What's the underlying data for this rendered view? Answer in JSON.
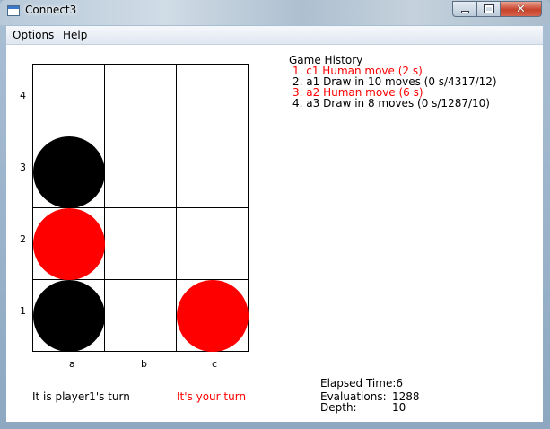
{
  "window": {
    "title": "Connect3",
    "colors": {
      "red": "#ff0000",
      "black": "#000000"
    }
  },
  "menu": {
    "items": [
      "Options",
      "Help"
    ]
  },
  "board": {
    "rows": [
      "4",
      "3",
      "2",
      "1"
    ],
    "columns": [
      "a",
      "b",
      "c"
    ],
    "discs": [
      {
        "col": "a",
        "row": "3",
        "color": "black"
      },
      {
        "col": "a",
        "row": "2",
        "color": "red"
      },
      {
        "col": "a",
        "row": "1",
        "color": "black"
      },
      {
        "col": "c",
        "row": "1",
        "color": "red"
      }
    ]
  },
  "history": {
    "title": "Game History",
    "entries": [
      {
        "text": "1. c1 Human move (2 s)",
        "color": "#ff0000"
      },
      {
        "text": "2. a1 Draw in 10 moves (0 s/4317/12)",
        "color": "#000000"
      },
      {
        "text": "3. a2 Human move (6 s)",
        "color": "#ff0000"
      },
      {
        "text": "4. a3 Draw in 8 moves (0 s/1287/10)",
        "color": "#000000"
      }
    ]
  },
  "status": {
    "turn": "It is player1's turn",
    "your_turn": "It's your turn",
    "elapsed": "Elapsed Time:6",
    "evaluations_label": "Evaluations:",
    "evaluations_value": "1288",
    "depth_label": "Depth:",
    "depth_value": "10"
  }
}
